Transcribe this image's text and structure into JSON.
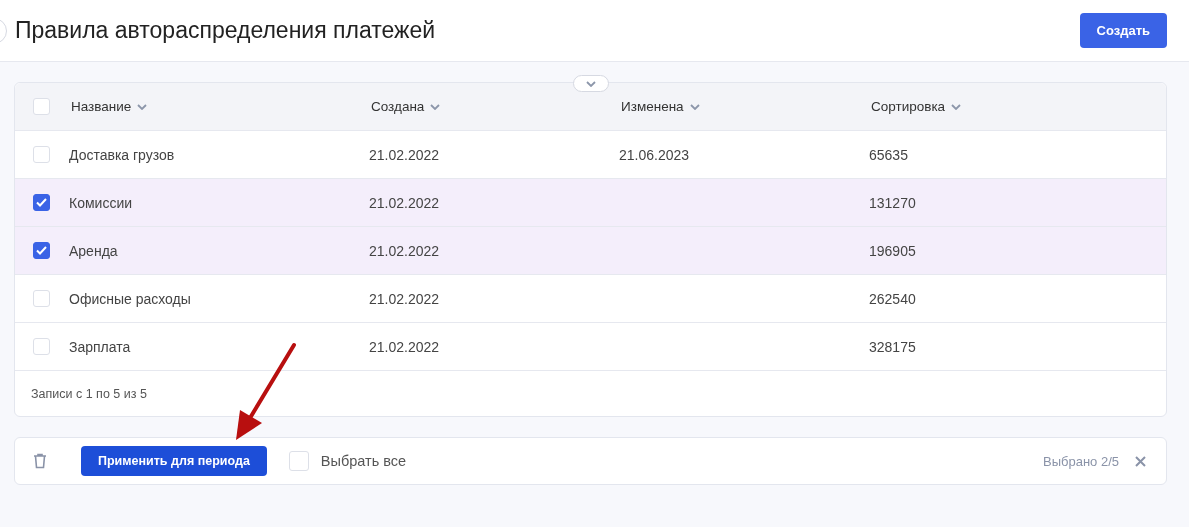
{
  "header": {
    "title": "Правила автораспределения платежей",
    "create_button": "Создать"
  },
  "table": {
    "columns": [
      {
        "label": "Название"
      },
      {
        "label": "Создана"
      },
      {
        "label": "Изменена"
      },
      {
        "label": "Сортировка"
      }
    ],
    "header_checked": false,
    "filters_expanded": false,
    "rows": [
      {
        "name": "Доставка грузов",
        "created": "21.02.2022",
        "modified": "21.06.2023",
        "sort": "65635",
        "selected": false
      },
      {
        "name": "Комиссии",
        "created": "21.02.2022",
        "modified": "",
        "sort": "131270",
        "selected": true
      },
      {
        "name": "Аренда",
        "created": "21.02.2022",
        "modified": "",
        "sort": "196905",
        "selected": true
      },
      {
        "name": "Офисные расходы",
        "created": "21.02.2022",
        "modified": "",
        "sort": "262540",
        "selected": false
      },
      {
        "name": "Зарплата",
        "created": "21.02.2022",
        "modified": "",
        "sort": "328175",
        "selected": false
      }
    ],
    "footer": "Записи с 1 по 5 из 5"
  },
  "action_bar": {
    "apply_button": "Применить для периода",
    "select_all": {
      "label": "Выбрать все",
      "checked": false
    },
    "selected_count": "Выбрано 2/5"
  }
}
